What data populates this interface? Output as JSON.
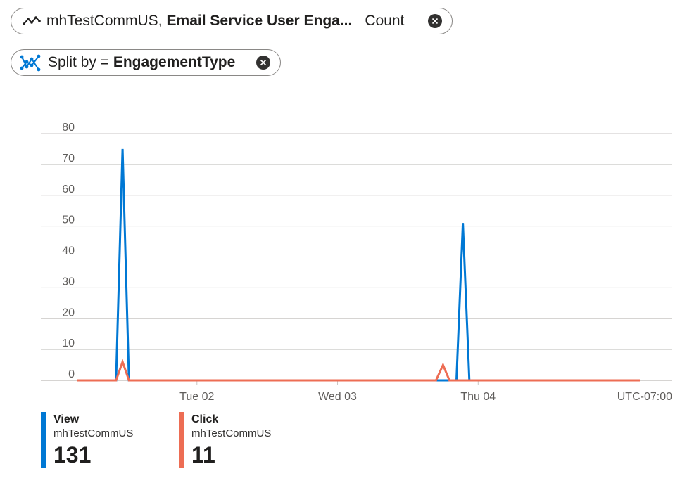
{
  "filters": {
    "metric": {
      "resource": "mhTestCommUS,",
      "metric_name": "Email Service User Enga...",
      "aggregation": "Count"
    },
    "split": {
      "prefix": "Split by = ",
      "dimension": "EngagementType"
    }
  },
  "timezone": "UTC-07:00",
  "colors": {
    "view": "#0078d4",
    "click": "#ed6d54",
    "grid": "#c8c6c4"
  },
  "chart_data": {
    "type": "line",
    "y_ticks": [
      "80",
      "70",
      "60",
      "50",
      "40",
      "30",
      "20",
      "10",
      "0"
    ],
    "ylim": [
      0,
      80
    ],
    "x_tick_labels": [
      {
        "label": "Tue 02",
        "t": 48
      },
      {
        "label": "Wed 03",
        "t": 72
      },
      {
        "label": "Thu 04",
        "t": 96
      }
    ],
    "xlim": [
      27.6,
      123.6
    ],
    "series": [
      {
        "name": "View",
        "resource": "mhTestCommUS",
        "total": "131",
        "color": "#0078d4",
        "points": [
          [
            27.6,
            0
          ],
          [
            34.2,
            0
          ],
          [
            35.3,
            75
          ],
          [
            36.4,
            0
          ],
          [
            92.3,
            0
          ],
          [
            93.4,
            51
          ],
          [
            94.5,
            0
          ],
          [
            123.6,
            0
          ]
        ]
      },
      {
        "name": "Click",
        "resource": "mhTestCommUS",
        "total": "11",
        "color": "#ed6d54",
        "points": [
          [
            27.6,
            0
          ],
          [
            34.2,
            0
          ],
          [
            35.3,
            6
          ],
          [
            36.4,
            0
          ],
          [
            88.8,
            0
          ],
          [
            90.0,
            5
          ],
          [
            91.1,
            0
          ],
          [
            123.6,
            0
          ]
        ]
      }
    ]
  }
}
